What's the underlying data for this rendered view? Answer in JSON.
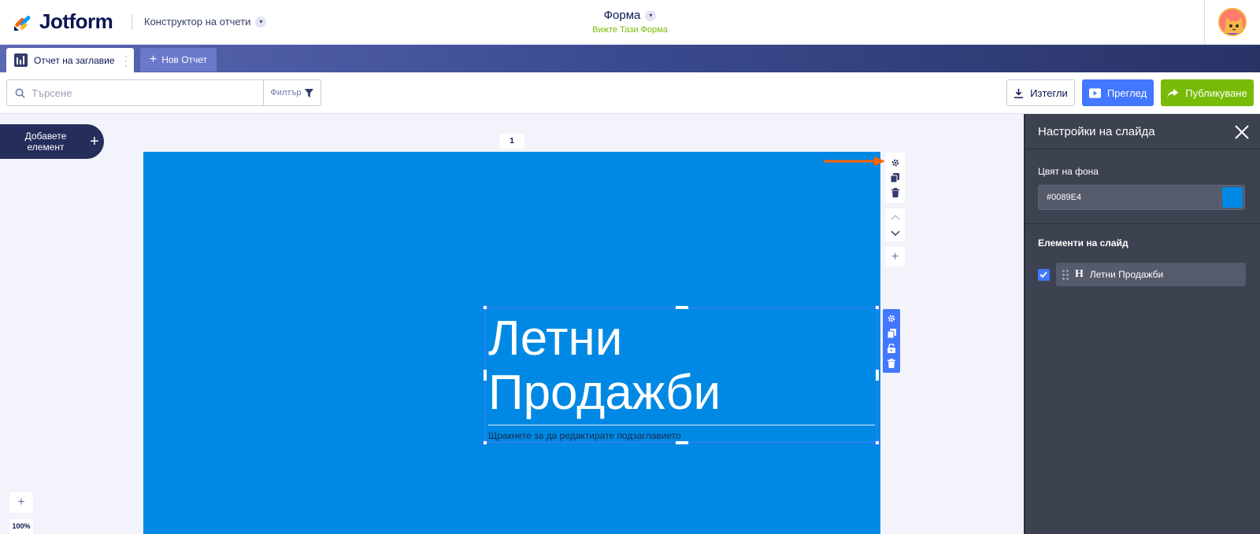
{
  "brand": {
    "name": "Jotform"
  },
  "header": {
    "app_name": "Конструктор на отчети",
    "form_title": "Форма",
    "form_link": "Вижте Тази Форма"
  },
  "tabs": {
    "active_label": "Отчет на заглавие",
    "new_label": "Нов Отчет"
  },
  "toolbar": {
    "search_placeholder": "Търсене",
    "filter_label": "Филтър",
    "download_label": "Изтегли",
    "preview_label": "Преглед",
    "publish_label": "Публикуване"
  },
  "canvas": {
    "add_element_label": "Добавете елемент",
    "page_number": "1",
    "zoom_level": "100%",
    "slide_background": "#0089E4",
    "headline": "Летни Продажби",
    "subtitle_placeholder": "Щракнете за да редактирате подзаглавието"
  },
  "panel": {
    "title": "Настройки на слайда",
    "bg_color_label": "Цвят на фона",
    "bg_color_value": "#0089E4",
    "elements_label": "Елементи на слайд",
    "elements": [
      {
        "type_glyph": "H",
        "label": "Летни Продажби",
        "checked": true
      }
    ]
  },
  "colors": {
    "accent_blue": "#4277ff",
    "publish_green": "#78bb07",
    "arrow_orange": "#ff6100",
    "panel_bg": "#3d4251"
  }
}
